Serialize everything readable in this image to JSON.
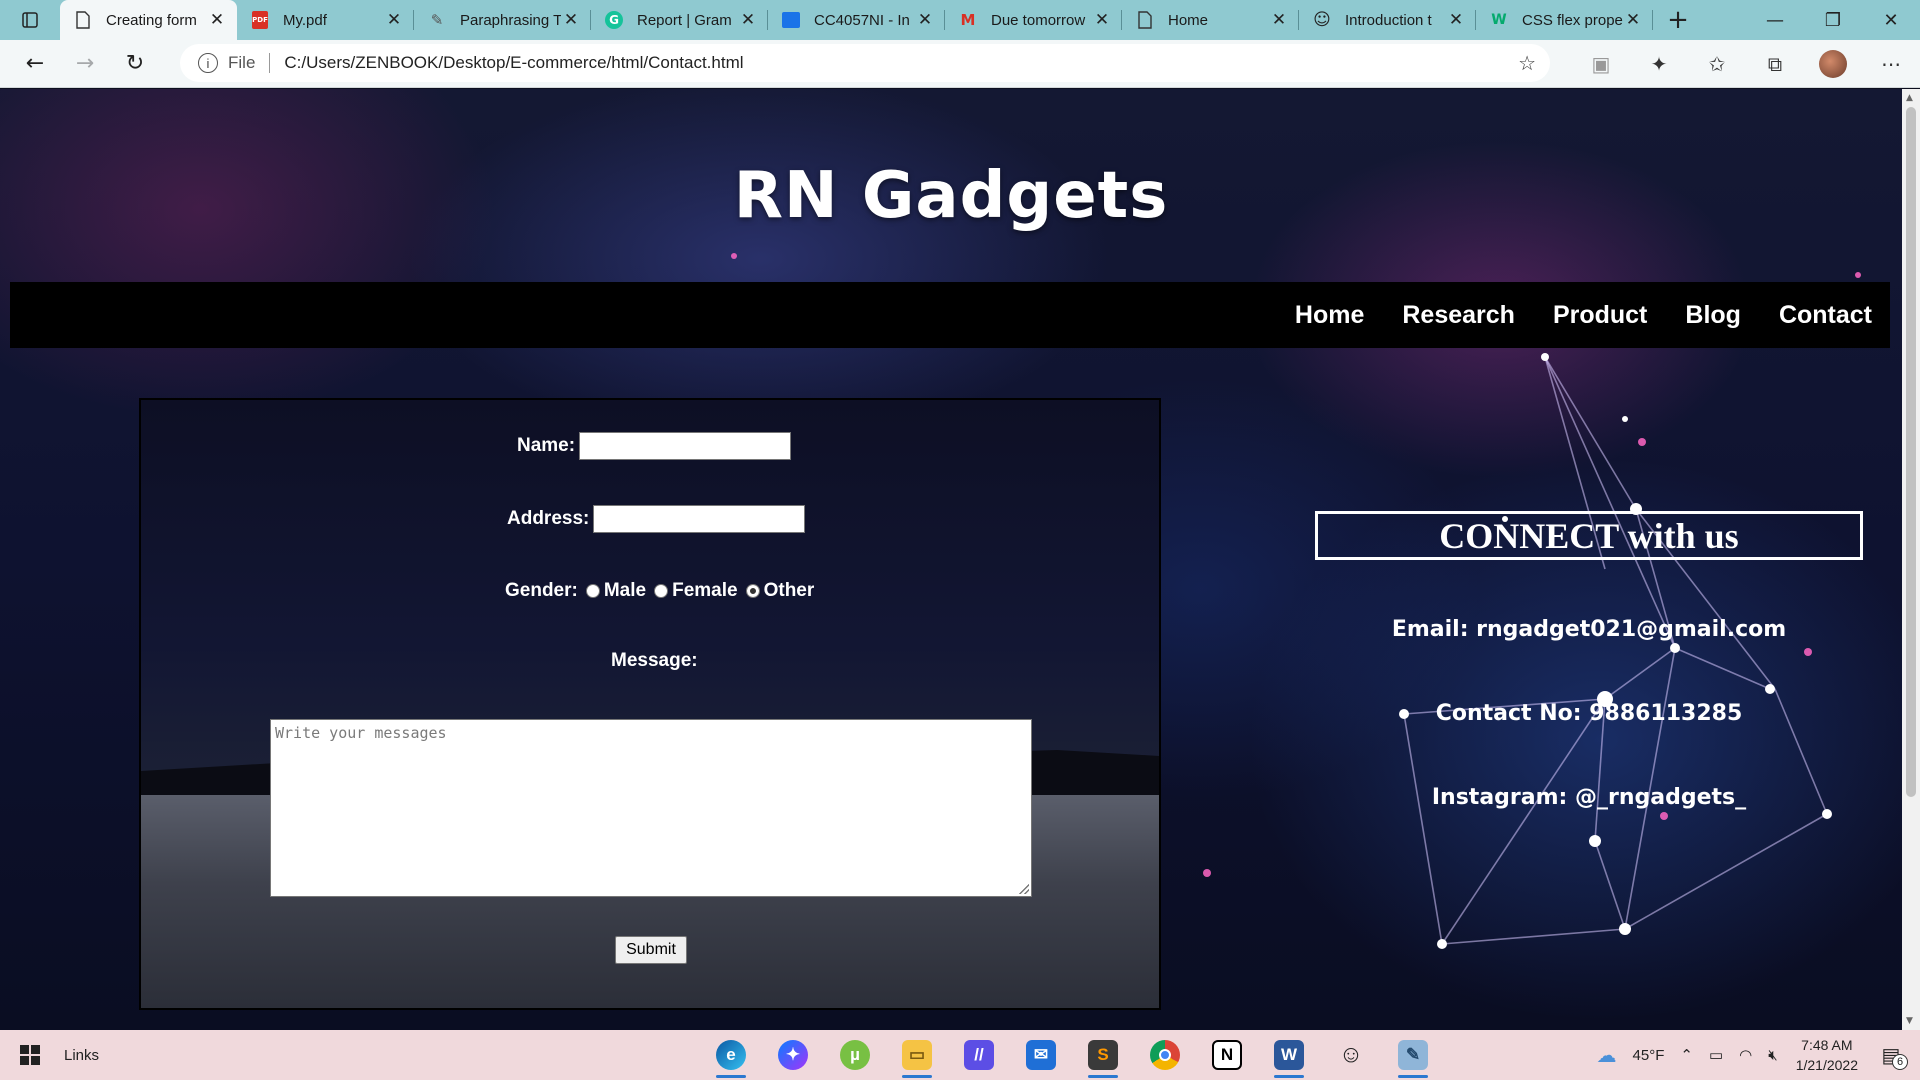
{
  "browser": {
    "tabs": [
      {
        "label": "Creating form",
        "icon": "page-icon",
        "active": true
      },
      {
        "label": "My.pdf",
        "icon": "pdf-icon",
        "active": false
      },
      {
        "label": "Paraphrasing T",
        "icon": "quill-icon",
        "active": false
      },
      {
        "label": "Report | Gram",
        "icon": "grammarly-icon",
        "active": false
      },
      {
        "label": "CC4057NI - In",
        "icon": "classroom-icon",
        "active": false
      },
      {
        "label": "Due tomorrow",
        "icon": "gmail-icon",
        "active": false
      },
      {
        "label": "Home",
        "icon": "page-icon",
        "active": false
      },
      {
        "label": "Introduction t",
        "icon": "smiley-icon",
        "active": false
      },
      {
        "label": "CSS flex prope",
        "icon": "w3schools-icon",
        "active": false
      }
    ],
    "address": {
      "scheme_label": "File",
      "url": "C:/Users/ZENBOOK/Desktop/E-commerce/html/Contact.html"
    }
  },
  "page": {
    "site_title": "RN Gadgets",
    "nav": [
      "Home",
      "Research",
      "Product",
      "Blog",
      "Contact"
    ],
    "form": {
      "name_label": "Name:",
      "name_value": "",
      "address_label": "Address:",
      "address_value": "",
      "gender_label": "Gender:",
      "gender_options": [
        "Male",
        "Female",
        "Other"
      ],
      "gender_selected": "Other",
      "message_label": "Message:",
      "message_placeholder": "Write your messages",
      "submit_label": "Submit"
    },
    "connect": {
      "heading": "CONNECT with us",
      "email": "Email: rngadget021@gmail.com",
      "contact": "Contact No: 9886113285",
      "instagram": "Instagram: @_rngadgets_"
    }
  },
  "taskbar": {
    "links_label": "Links",
    "apps": [
      "edge-icon",
      "messenger-icon",
      "utorrent-icon",
      "file-explorer-icon",
      "visual-studio-icon",
      "mail-icon",
      "sublime-text-icon",
      "chrome-icon",
      "notion-icon",
      "word-icon",
      "emoji-icon",
      "notepad-icon"
    ],
    "weather": "45°F",
    "time": "7:48 AM",
    "date": "1/21/2022",
    "notifications": "6"
  }
}
